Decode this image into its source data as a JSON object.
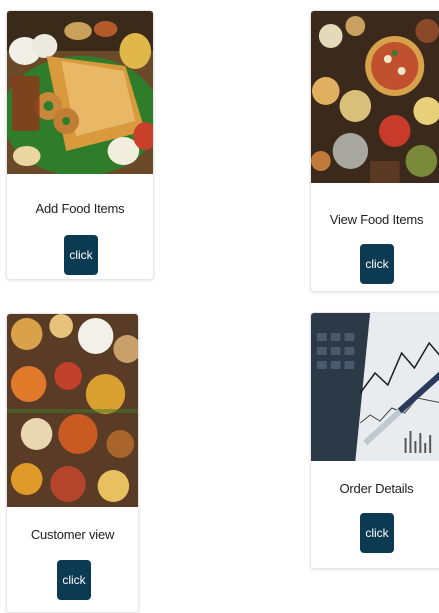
{
  "cards": [
    {
      "title": "Add Food Items",
      "button_label": "click",
      "image": "south-indian-dosa-platter-photo"
    },
    {
      "title": "View Food Items",
      "button_label": "click",
      "image": "pizza-and-dishes-table-photo"
    },
    {
      "title": "Customer view",
      "button_label": "click",
      "image": "indian-curry-spread-photo"
    },
    {
      "title": "Order Details",
      "button_label": "click",
      "image": "calculator-financial-chart-photo"
    }
  ],
  "colors": {
    "button_bg": "#0c3a52",
    "button_text": "#ffffff",
    "card_border": "#e6e6e6"
  }
}
